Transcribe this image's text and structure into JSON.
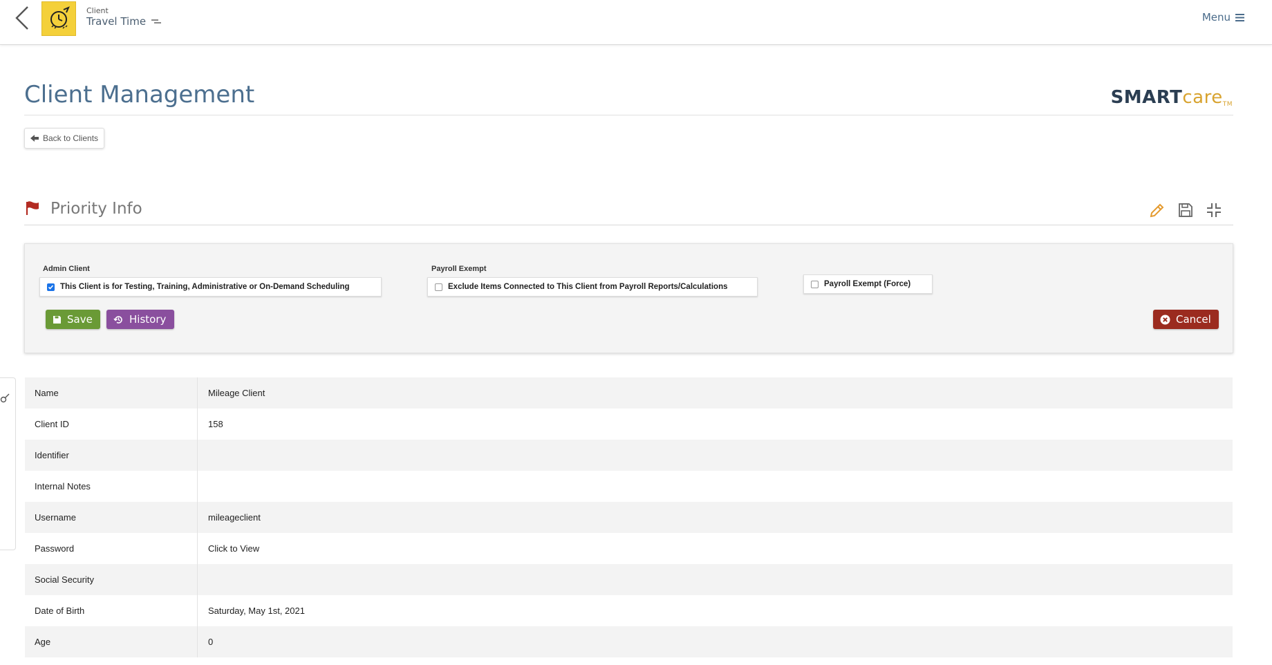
{
  "topbar": {
    "breadcrumb_small": "Client",
    "breadcrumb_title": "Travel Time",
    "menu_label": "Menu"
  },
  "page": {
    "title": "Client Management",
    "brand_part1": "SMART",
    "brand_part2": "care",
    "brand_tm": "TM",
    "back_button_label": "Back to Clients"
  },
  "section": {
    "title": "Priority Info",
    "admin_client_label": "Admin Client",
    "admin_client_option": "This Client is for Testing, Training, Administrative or On-Demand Scheduling",
    "admin_client_checked": true,
    "payroll_exempt_label": "Payroll Exempt",
    "payroll_exempt_option": "Exclude Items Connected to This Client from Payroll Reports/Calculations",
    "payroll_exempt_checked": false,
    "payroll_exempt_force_option": "Payroll Exempt (Force)",
    "payroll_exempt_force_checked": false,
    "save_label": "Save",
    "history_label": "History",
    "cancel_label": "Cancel"
  },
  "details": {
    "rows": [
      {
        "key": "Name",
        "value": "Mileage Client"
      },
      {
        "key": "Client ID",
        "value": "158"
      },
      {
        "key": "Identifier",
        "value": ""
      },
      {
        "key": "Internal Notes",
        "value": ""
      },
      {
        "key": "Username",
        "value": "mileageclient"
      },
      {
        "key": "Password",
        "value": "Click to View"
      },
      {
        "key": "Social Security",
        "value": ""
      },
      {
        "key": "Date of Birth",
        "value": "Saturday, May 1st, 2021"
      },
      {
        "key": "Age",
        "value": "0"
      }
    ]
  },
  "colors": {
    "save": "#6a9a36",
    "history": "#8a4f9e",
    "cancel": "#9b2b1f",
    "title": "#4c6f8f",
    "brand_dark": "#2b3e52",
    "brand_gold": "#d8a32f",
    "edit_icon": "#e49a2e"
  }
}
